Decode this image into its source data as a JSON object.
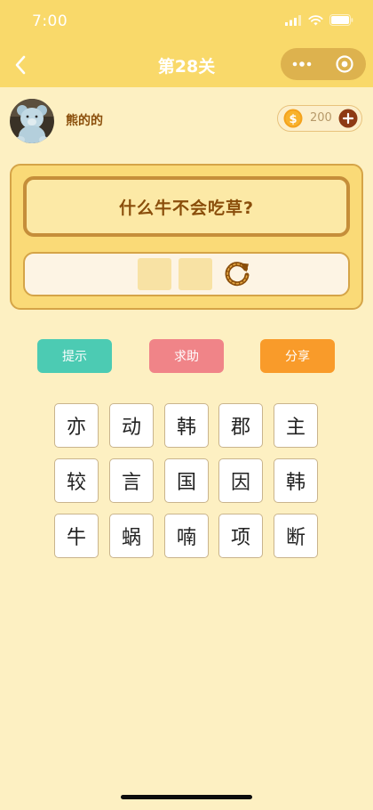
{
  "status_bar": {
    "time": "7:00"
  },
  "nav": {
    "title": "第28关",
    "icons": [
      "back-chevron-icon",
      "more-dots-icon",
      "target-circle-icon"
    ]
  },
  "profile": {
    "username": "熊的的",
    "coins": "200",
    "icons": [
      "dollar-coin-icon",
      "plus-icon"
    ]
  },
  "puzzle": {
    "question": "什么牛不会吃草?",
    "answer_slots": [
      "",
      ""
    ],
    "reset_icon": "refresh-icon"
  },
  "actions": {
    "hint_label": "提示",
    "help_label": "求助",
    "share_label": "分享"
  },
  "characters": [
    [
      "亦",
      "动",
      "韩",
      "郡",
      "主"
    ],
    [
      "较",
      "言",
      "国",
      "因",
      "韩"
    ],
    [
      "牛",
      "蜗",
      "喃",
      "项",
      "断"
    ]
  ],
  "colors": {
    "header": "#F9D96A",
    "background": "#FDF0C2",
    "hint": "#4CCBB3",
    "help": "#F08488",
    "share": "#F99B2A",
    "text_brown": "#8A4E0B"
  }
}
